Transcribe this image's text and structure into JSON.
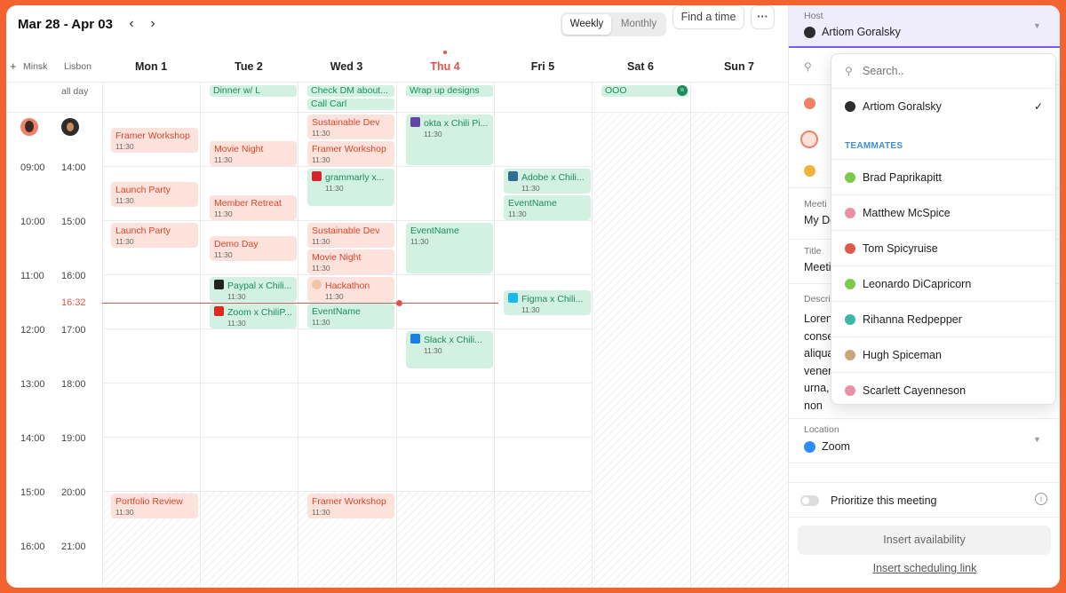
{
  "header": {
    "range": "Mar 28 - Apr 03",
    "view_weekly": "Weekly",
    "view_monthly": "Monthly",
    "find_time": "Find a time",
    "more": "···"
  },
  "timezones": {
    "add": "+",
    "tz1": "Minsk",
    "tz2": "Lisbon"
  },
  "days": [
    "Mon 1",
    "Tue 2",
    "Wed 3",
    "Thu 4",
    "Fri 5",
    "Sat 6",
    "Sun 7"
  ],
  "allday_label": "all day",
  "allday_events": [
    {
      "title": "Dinner w/ L"
    },
    {
      "title": "Check DM about..."
    },
    {
      "title": "Call Carl"
    },
    {
      "title": "Wrap up designs"
    },
    {
      "title": "OOO"
    }
  ],
  "hours_minsk": [
    "09:00",
    "10:00",
    "11:00",
    "12:00",
    "13:00",
    "14:00",
    "15:00",
    "16:00"
  ],
  "hours_lisbon": [
    "14:00",
    "15:00",
    "16:00",
    "17:00",
    "18:00",
    "19:00",
    "20:00",
    "21:00"
  ],
  "now": "16:32",
  "events": [
    {
      "title": "Framer Workshop",
      "time": "11:30"
    },
    {
      "title": "Launch Party",
      "time": "11:30"
    },
    {
      "title": "Launch Party",
      "time": "11:30"
    },
    {
      "title": "Portfolio Review",
      "time": "11:30"
    },
    {
      "title": "Movie Night",
      "time": "11:30"
    },
    {
      "title": "Member Retreat",
      "time": "11:30"
    },
    {
      "title": "Demo Day",
      "time": "11:30"
    },
    {
      "title": "Paypal x Chili...",
      "time": "11:30"
    },
    {
      "title": "Zoom x ChiliP...",
      "time": "11:30"
    },
    {
      "title": "Sustainable Dev",
      "time": "11:30"
    },
    {
      "title": "Framer Workshop",
      "time": "11:30"
    },
    {
      "title": "grammarly x...",
      "time": "11:30"
    },
    {
      "title": "Sustainable Dev",
      "time": "11:30"
    },
    {
      "title": "Movie Night",
      "time": "11:30"
    },
    {
      "title": "Hackathon",
      "time": "11:30"
    },
    {
      "title": "EventName",
      "time": "11:30"
    },
    {
      "title": "Framer Workshop",
      "time": "11:30"
    },
    {
      "title": "okta x Chili Pi...",
      "time": "11:30"
    },
    {
      "title": "EventName",
      "time": "11:30"
    },
    {
      "title": "Slack x Chili...",
      "time": "11:30"
    },
    {
      "title": "Adobe x Chili...",
      "time": "11:30"
    },
    {
      "title": "EventName",
      "time": "11:30"
    },
    {
      "title": "Figma x Chili...",
      "time": "11:30"
    }
  ],
  "side": {
    "host_label": "Host",
    "host_name": "Artiom Goralsky",
    "meeting_label": "Meeti",
    "meeting_value": "My De",
    "title_label": "Title",
    "title_value": "Meeti",
    "desc_label": "Descri",
    "desc_lines": [
      "Loren",
      "conse",
      "aliqua",
      "vener",
      "urna,",
      "non"
    ],
    "location_label": "Location",
    "location_value": "Zoom",
    "prioritize": "Prioritize this meeting",
    "insert_availability": "Insert availability",
    "insert_link": "Insert scheduling link"
  },
  "dropdown": {
    "search_placeholder": "Search..",
    "selected": "Artiom Goralsky",
    "section": "TEAMMATES",
    "teammates": [
      "Brad Paprikapitt",
      "Matthew McSpice",
      "Tom Spicyruise",
      "Leonardo DiCapricorn",
      "Rihanna Redpepper",
      "Hugh Spiceman",
      "Scarlett Cayenneson"
    ]
  },
  "colors": {
    "accent": "#7b5cf0",
    "red_event": "#fde2dc",
    "green_event": "#d2f1e3",
    "today": "#e5534b",
    "frame": "#f26330"
  }
}
